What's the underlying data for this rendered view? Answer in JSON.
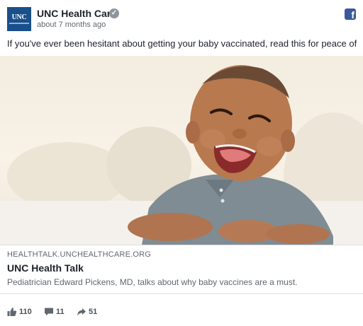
{
  "post": {
    "page_name": "UNC Health Care",
    "avatar_text": "UNC",
    "timestamp": "about 7 months ago",
    "message": "If you've ever been hesitant about getting your baby vaccinated, read this for peace of mind.",
    "verified_glyph": "✓",
    "platform_icon": "facebook-icon",
    "platform_glyph": "f"
  },
  "link": {
    "domain": "HEALTHTALK.UNCHEALTHCARE.ORG",
    "title": "UNC Health Talk",
    "description": "Pediatrician Edward Pickens, MD, talks about why baby vaccines are a must."
  },
  "engagement": {
    "likes": "110",
    "comments": "11",
    "shares": "51"
  },
  "colors": {
    "facebook_blue": "#3b5998",
    "avatar_blue": "#1a4f8b",
    "text_primary": "#1d2129",
    "text_secondary": "#606770"
  }
}
